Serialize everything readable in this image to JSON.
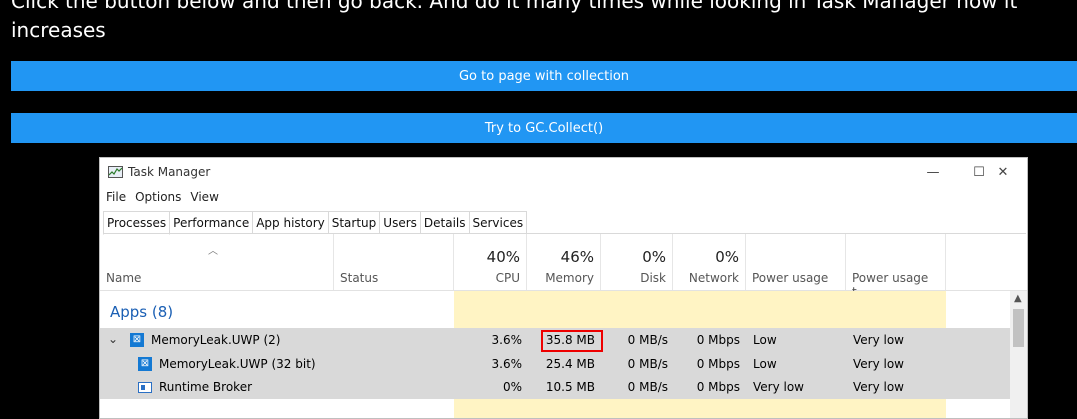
{
  "intro": {
    "line1": "Click the button below and then go back. And do it many times while looking in Task Manager how it",
    "line2": "increases"
  },
  "buttons": {
    "goto": "Go to page with collection",
    "gc": "Try to GC.Collect()"
  },
  "taskmgr": {
    "title": "Task Manager",
    "window_controls": {
      "min": "—",
      "max": "☐",
      "close": "✕"
    },
    "menu": [
      "File",
      "Options",
      "View"
    ],
    "tabs": [
      "Processes",
      "Performance",
      "App history",
      "Startup",
      "Users",
      "Details",
      "Services"
    ],
    "active_tab": "Processes",
    "columns": {
      "name": "Name",
      "status": "Status",
      "cpu": {
        "pct": "40%",
        "label": "CPU"
      },
      "memory": {
        "pct": "46%",
        "label": "Memory"
      },
      "disk": {
        "pct": "0%",
        "label": "Disk"
      },
      "network": {
        "pct": "0%",
        "label": "Network"
      },
      "power": "Power usage",
      "power_trend": "Power usage t..."
    },
    "group": "Apps (8)",
    "rows": [
      {
        "expand": "⌄",
        "name": "MemoryLeak.UWP (2)",
        "cpu": "3.6%",
        "memory": "35.8 MB",
        "disk": "0 MB/s",
        "network": "0 Mbps",
        "power": "Low",
        "power_trend": "Very low"
      },
      {
        "name": "MemoryLeak.UWP (32 bit)",
        "cpu": "3.6%",
        "memory": "25.4 MB",
        "disk": "0 MB/s",
        "network": "0 Mbps",
        "power": "Low",
        "power_trend": "Very low"
      },
      {
        "name": "Runtime Broker",
        "cpu": "0%",
        "memory": "10.5 MB",
        "disk": "0 MB/s",
        "network": "0 Mbps",
        "power": "Very low",
        "power_trend": "Very low"
      }
    ],
    "colors": {
      "accent": "#2196f3",
      "highlight": "#fff4c4",
      "red_box": "#e00000",
      "group_text": "#1a5fb4"
    }
  }
}
